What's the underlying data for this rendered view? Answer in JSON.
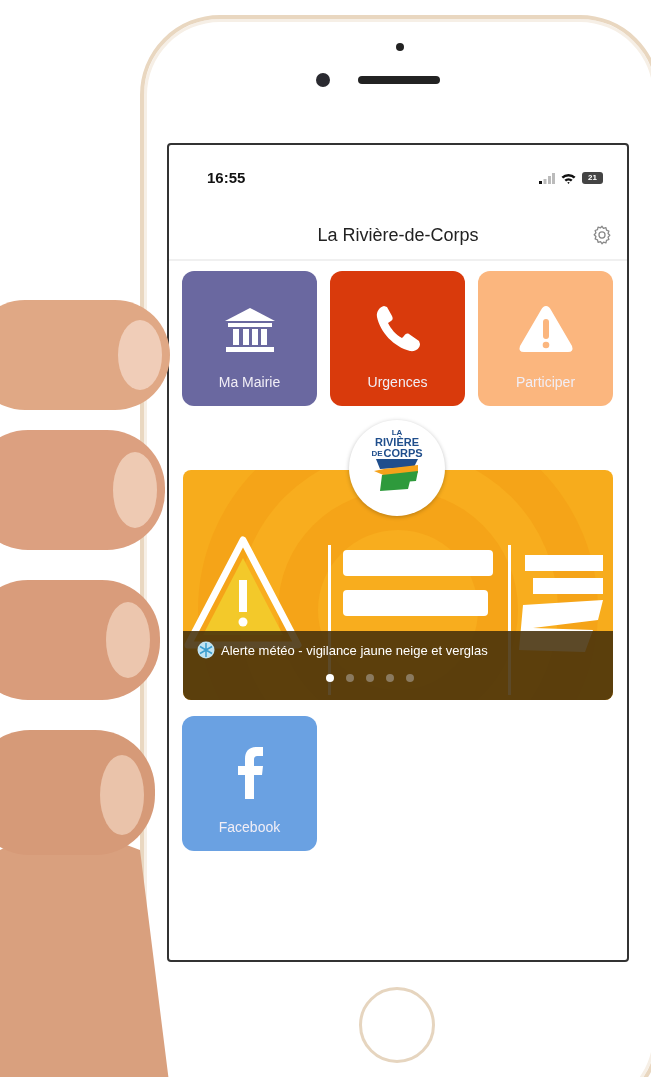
{
  "status_bar": {
    "time": "16:55",
    "battery": "21"
  },
  "header": {
    "title": "La Rivière-de-Corps"
  },
  "tiles": [
    {
      "label": "Ma Mairie",
      "kind": "building",
      "color": "#6a68a0"
    },
    {
      "label": "Urgences",
      "kind": "phone",
      "color": "#d93a0c"
    },
    {
      "label": "Participer",
      "kind": "warning",
      "color": "#fbb67e"
    }
  ],
  "logo": {
    "lines": [
      "LA",
      "RIVIÈRE",
      "DE",
      "CORPS"
    ]
  },
  "banner": {
    "kind": "picture",
    "caption": "Alerte météo - vigilance jaune neige et verglas",
    "dots": [
      {
        "selected": true
      },
      {
        "selected": false
      },
      {
        "selected": false
      },
      {
        "selected": false
      },
      {
        "selected": false
      }
    ]
  },
  "social_tiles": [
    {
      "label": "Facebook",
      "kind": "facebook",
      "color": "#6aa1e2"
    }
  ]
}
